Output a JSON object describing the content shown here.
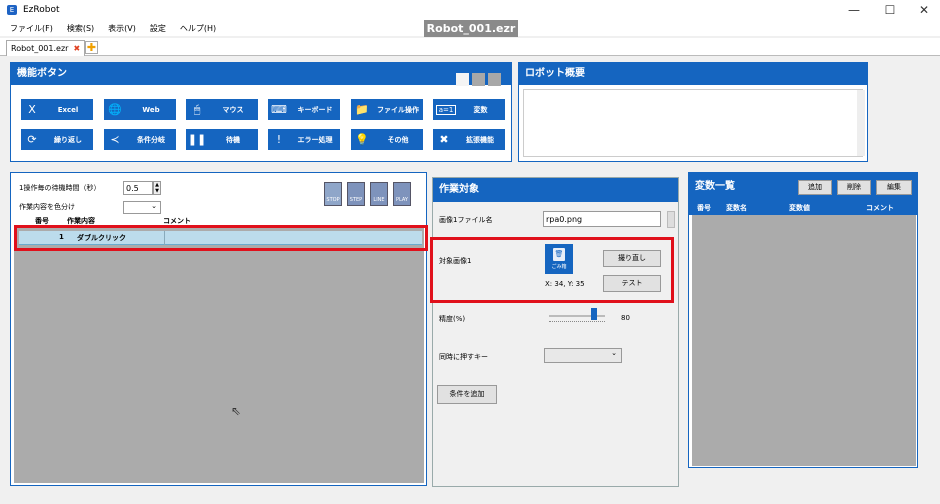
{
  "app": {
    "title": "EzRobot",
    "file_chip": "Robot_001.ezr"
  },
  "menu": [
    "ファイル(F)",
    "検索(S)",
    "表示(V)",
    "設定",
    "ヘルプ(H)"
  ],
  "tab": {
    "label": "Robot_001.ezr",
    "close": "✖",
    "add": "✚"
  },
  "window": {
    "minimize": "—",
    "maximize": "☐",
    "close": "✕"
  },
  "function_panel": {
    "title": "機能ボタン",
    "buttons": [
      {
        "label": "Excel",
        "icon": "X"
      },
      {
        "label": "Web",
        "icon": "🌐"
      },
      {
        "label": "マウス",
        "icon": "🖱"
      },
      {
        "label": "キーボード",
        "icon": "⌨"
      },
      {
        "label": "ファイル操作",
        "icon": "📁"
      },
      {
        "label": "変数",
        "icon": "a=1"
      },
      {
        "label": "繰り返し",
        "icon": "⟳"
      },
      {
        "label": "条件分岐",
        "icon": "≺"
      },
      {
        "label": "待機",
        "icon": "❚❚"
      },
      {
        "label": "エラー処理",
        "icon": "!"
      },
      {
        "label": "その他",
        "icon": "💡"
      },
      {
        "label": "拡張機能",
        "icon": "✖"
      }
    ]
  },
  "robot_summary": {
    "title": "ロボット概要"
  },
  "script_panel": {
    "wait_label": "1操作毎の待機時間（秒）",
    "wait_value": "0.5",
    "color_label": "作業内容を色分け",
    "toolbar": [
      "STOP",
      "STEP",
      "LINE",
      "PLAY"
    ],
    "columns": [
      "番号",
      "作業内容",
      "コメント"
    ],
    "rows": [
      {
        "no": "1",
        "action": "ダブルクリック",
        "comment": ""
      }
    ]
  },
  "work_target": {
    "title": "作業対象",
    "image_file_label": "画像1ファイル名",
    "image_file_value": "rpa0.png",
    "target_image_label": "対象画像1",
    "image_caption": "ごみ箱",
    "coords": "X: 34, Y: 35",
    "retake_button": "撮り直し",
    "test_button": "テスト",
    "precision_label": "精度(%)",
    "precision_value": "80",
    "precision_level": 80,
    "hotkey_label": "同時に押すキー",
    "add_condition_button": "条件を追加"
  },
  "variables": {
    "title": "変数一覧",
    "add_button": "追加",
    "delete_button": "削除",
    "edit_button": "編集",
    "columns": [
      "番号",
      "変数名",
      "変数値",
      "コメント"
    ]
  },
  "colors": {
    "accent": "#1565c0",
    "highlight": "#e0101b",
    "row_selected": "#bcdcec"
  }
}
